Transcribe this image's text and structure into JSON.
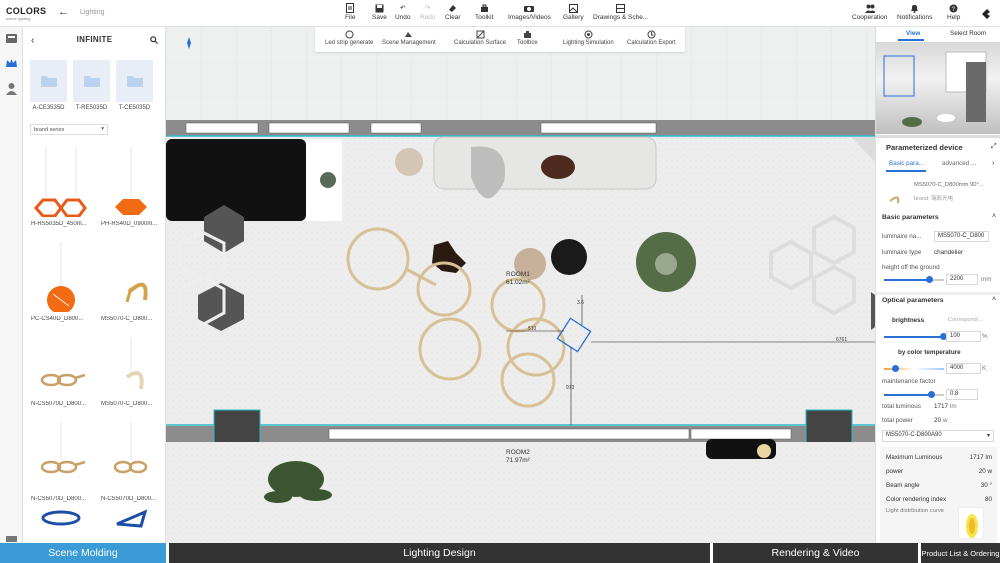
{
  "app": {
    "logo": "COLORS",
    "logo_sub": "scene lighting",
    "breadcrumb": "Lighting"
  },
  "toolbar": [
    {
      "id": "file",
      "label": "File"
    },
    {
      "id": "save",
      "label": "Save"
    },
    {
      "id": "undo",
      "label": "Undo"
    },
    {
      "id": "redo",
      "label": "Redo",
      "disabled": true
    },
    {
      "id": "clear",
      "label": "Clear"
    },
    {
      "id": "toolkit",
      "label": "Toolkit"
    },
    {
      "id": "images",
      "label": "Images/Videos"
    },
    {
      "id": "gallery",
      "label": "Gallery"
    },
    {
      "id": "drawings",
      "label": "Drawings & Sche..."
    }
  ],
  "right_toolbar": [
    {
      "id": "cooperation",
      "label": "Cooperation"
    },
    {
      "id": "notifications",
      "label": "Notifications"
    },
    {
      "id": "help",
      "label": "Help"
    }
  ],
  "subtoolbar": [
    {
      "id": "ledstrip",
      "label": "Led strip generate"
    },
    {
      "id": "scene",
      "label": "Scene Management"
    },
    {
      "id": "calcsurf",
      "label": "Calculation Surface"
    },
    {
      "id": "toolbox",
      "label": "Toolbox"
    },
    {
      "id": "lightsim",
      "label": "Lighting Simulation"
    },
    {
      "id": "calcexp",
      "label": "Calculation Export"
    }
  ],
  "left_panel": {
    "title": "INFINITE",
    "folders": [
      "A-CE3535D",
      "T-RE5035D",
      "T-CE5035D"
    ],
    "series_placeholder": "brand series",
    "products": [
      "H-RS5035D_450m...",
      "PH-RS40D_0900m...",
      "PC-CS40D_D800...",
      "MS5070-C_D800...",
      "N-CS5070D_D800...",
      "MS5070-C_D800...",
      "N-CS5070D_D800...",
      "N-CS5070D_D800..."
    ]
  },
  "canvas": {
    "room1": "ROOM1",
    "room1_area": "61.02m²",
    "room2": "ROOM2",
    "room2_area": "71.97m²",
    "dims": [
      "3.6",
      "510",
      "6761",
      "973"
    ]
  },
  "right_panel": {
    "tabs": [
      "View",
      "Select Room"
    ],
    "title": "Parameterized device",
    "subtabs": [
      "Basic para...",
      "advanced ..."
    ],
    "device_name": "MS5070-C_D800mm 90°...",
    "brand": "brand: 瑞彩光电",
    "basic_header": "Basic parameters",
    "luminaire_name_label": "luminaire na...",
    "luminaire_name_value": "MS5070-C_D800",
    "luminaire_type_label": "luminaire type",
    "luminaire_type_value": "chandelier",
    "height_label": "height off the ground",
    "height_value": "2200",
    "height_unit": "mm",
    "optical_header": "Optical parameters",
    "brightness_label": "brightness",
    "brightness_alt": "Correspondi...",
    "brightness_value": "100",
    "brightness_unit": "%",
    "brightness_level": 1.0,
    "colortemp_label": "by color temperature",
    "colortemp_value": "4000",
    "colortemp_unit": "K",
    "colortemp_level": 0.2,
    "maintenance_label": "maintenance factor",
    "maintenance_value": "0.8",
    "maintenance_level": 0.8,
    "total_luminous_label": "total luminous",
    "total_luminous_value": "1717",
    "total_luminous_unit": "lm",
    "total_power_label": "total power",
    "total_power_value": "20",
    "total_power_unit": "w",
    "model_select": "MS5070-C-D800A90",
    "specs": [
      {
        "label": "Maximum Luminous",
        "value": "1717",
        "unit": "lm"
      },
      {
        "label": "power",
        "value": "20",
        "unit": "w"
      },
      {
        "label": "Beam angle",
        "value": "30",
        "unit": "°"
      },
      {
        "label": "Color rendering index",
        "value": "80",
        "unit": ""
      }
    ],
    "distribution_label": "Light distribution curve"
  },
  "bottom": [
    "Scene Molding",
    "Lighting Design",
    "Rendering & Video",
    "Product List & Ordering"
  ],
  "colors": {
    "accent": "#2a6fd6",
    "bottom_active": "#3a9bd7",
    "wall_highlight": "#2fb7c9"
  }
}
